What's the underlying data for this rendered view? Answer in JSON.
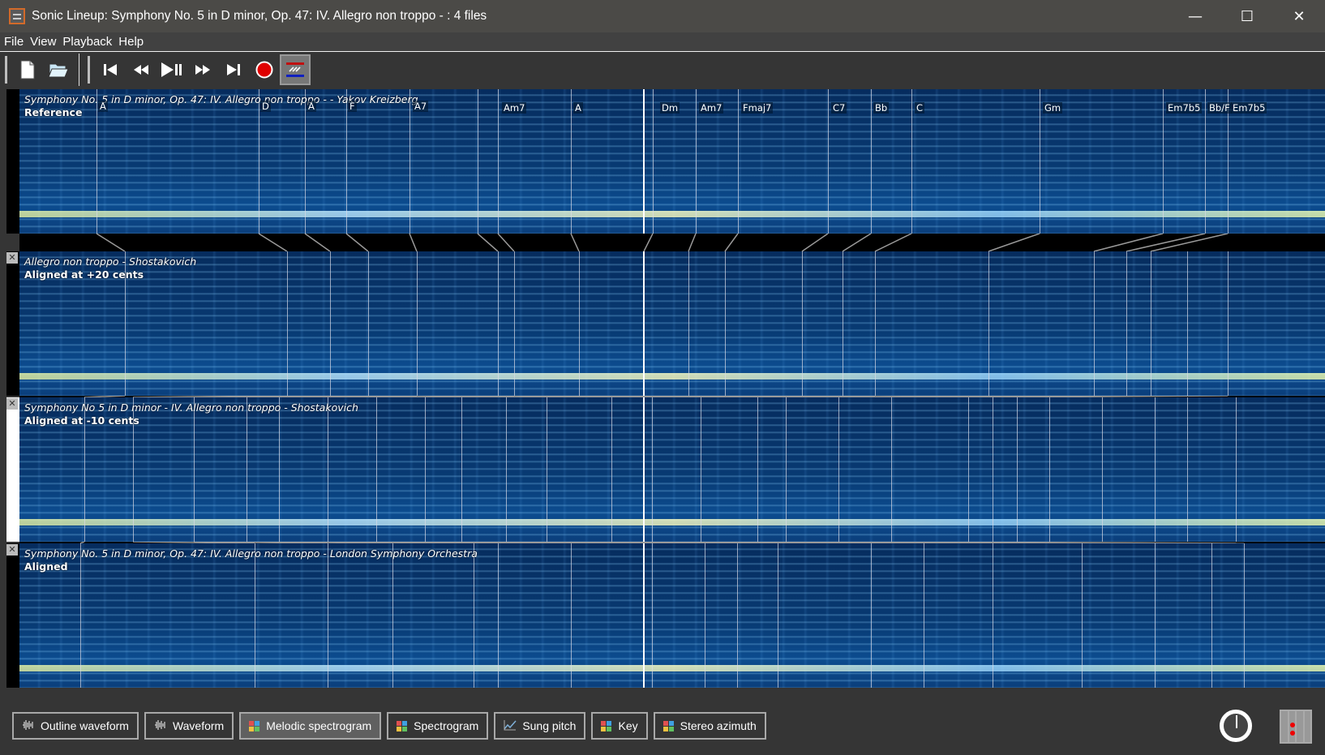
{
  "window": {
    "title": "Sonic Lineup: Symphony No. 5 in D minor, Op. 47: IV. Allegro non troppo - : 4 files",
    "controls": {
      "minimize": "—",
      "maximize": "☐",
      "close": "✕"
    }
  },
  "menu": [
    "File",
    "View",
    "Playback",
    "Help"
  ],
  "toolbar": {
    "buttons": [
      {
        "name": "new-session",
        "icon": "new-document-icon"
      },
      {
        "name": "open",
        "icon": "open-folder-icon"
      },
      {
        "name": "rewind-start",
        "icon": "skip-start-icon"
      },
      {
        "name": "rewind",
        "icon": "rewind-icon"
      },
      {
        "name": "play-pause",
        "icon": "play-pause-icon"
      },
      {
        "name": "fast-forward",
        "icon": "fast-forward-icon"
      },
      {
        "name": "forward-end",
        "icon": "skip-end-icon"
      },
      {
        "name": "record",
        "icon": "record-icon"
      },
      {
        "name": "align",
        "icon": "align-icon",
        "active": true
      }
    ]
  },
  "panes": [
    {
      "title": "Symphony No. 5 in D minor, Op. 47: IV. Allegro non troppo -  - Yakov Kreizberg",
      "subtitle": "Reference",
      "closable": false,
      "chords": [
        "A",
        "D",
        "A",
        "F",
        "A7",
        "Am7",
        "A",
        "Dm",
        "Am7",
        "Fmaj7",
        "C7",
        "Bb",
        "C",
        "Gm",
        "Em7b5",
        "Bb/F",
        "Em7b5"
      ]
    },
    {
      "title": "Allegro non troppo - Shostakovich",
      "subtitle": "Aligned at +20 cents",
      "closable": true
    },
    {
      "title": "Symphony No 5 in D minor - IV. Allegro non troppo - Shostakovich",
      "subtitle": "Aligned at -10 cents",
      "closable": true
    },
    {
      "title": "Symphony No. 5 in D minor, Op. 47: IV. Allegro non troppo - London Symphony Orchestra",
      "subtitle": "Aligned",
      "closable": true
    }
  ],
  "layer_buttons": [
    {
      "label": "Outline waveform",
      "icon": "waveform-icon",
      "active": false
    },
    {
      "label": "Waveform",
      "icon": "waveform-icon",
      "active": false
    },
    {
      "label": "Melodic spectrogram",
      "icon": "spectrogram-icon",
      "active": true
    },
    {
      "label": "Spectrogram",
      "icon": "spectrogram-icon",
      "active": false
    },
    {
      "label": "Sung pitch",
      "icon": "pitch-icon",
      "active": false
    },
    {
      "label": "Key",
      "icon": "spectrogram-icon",
      "active": false
    },
    {
      "label": "Stereo azimuth",
      "icon": "spectrogram-icon",
      "active": false
    }
  ],
  "colors": {
    "accent_record": "#e00000",
    "spectrogram_base": "#083a73",
    "peak": "#f7ff9a"
  }
}
